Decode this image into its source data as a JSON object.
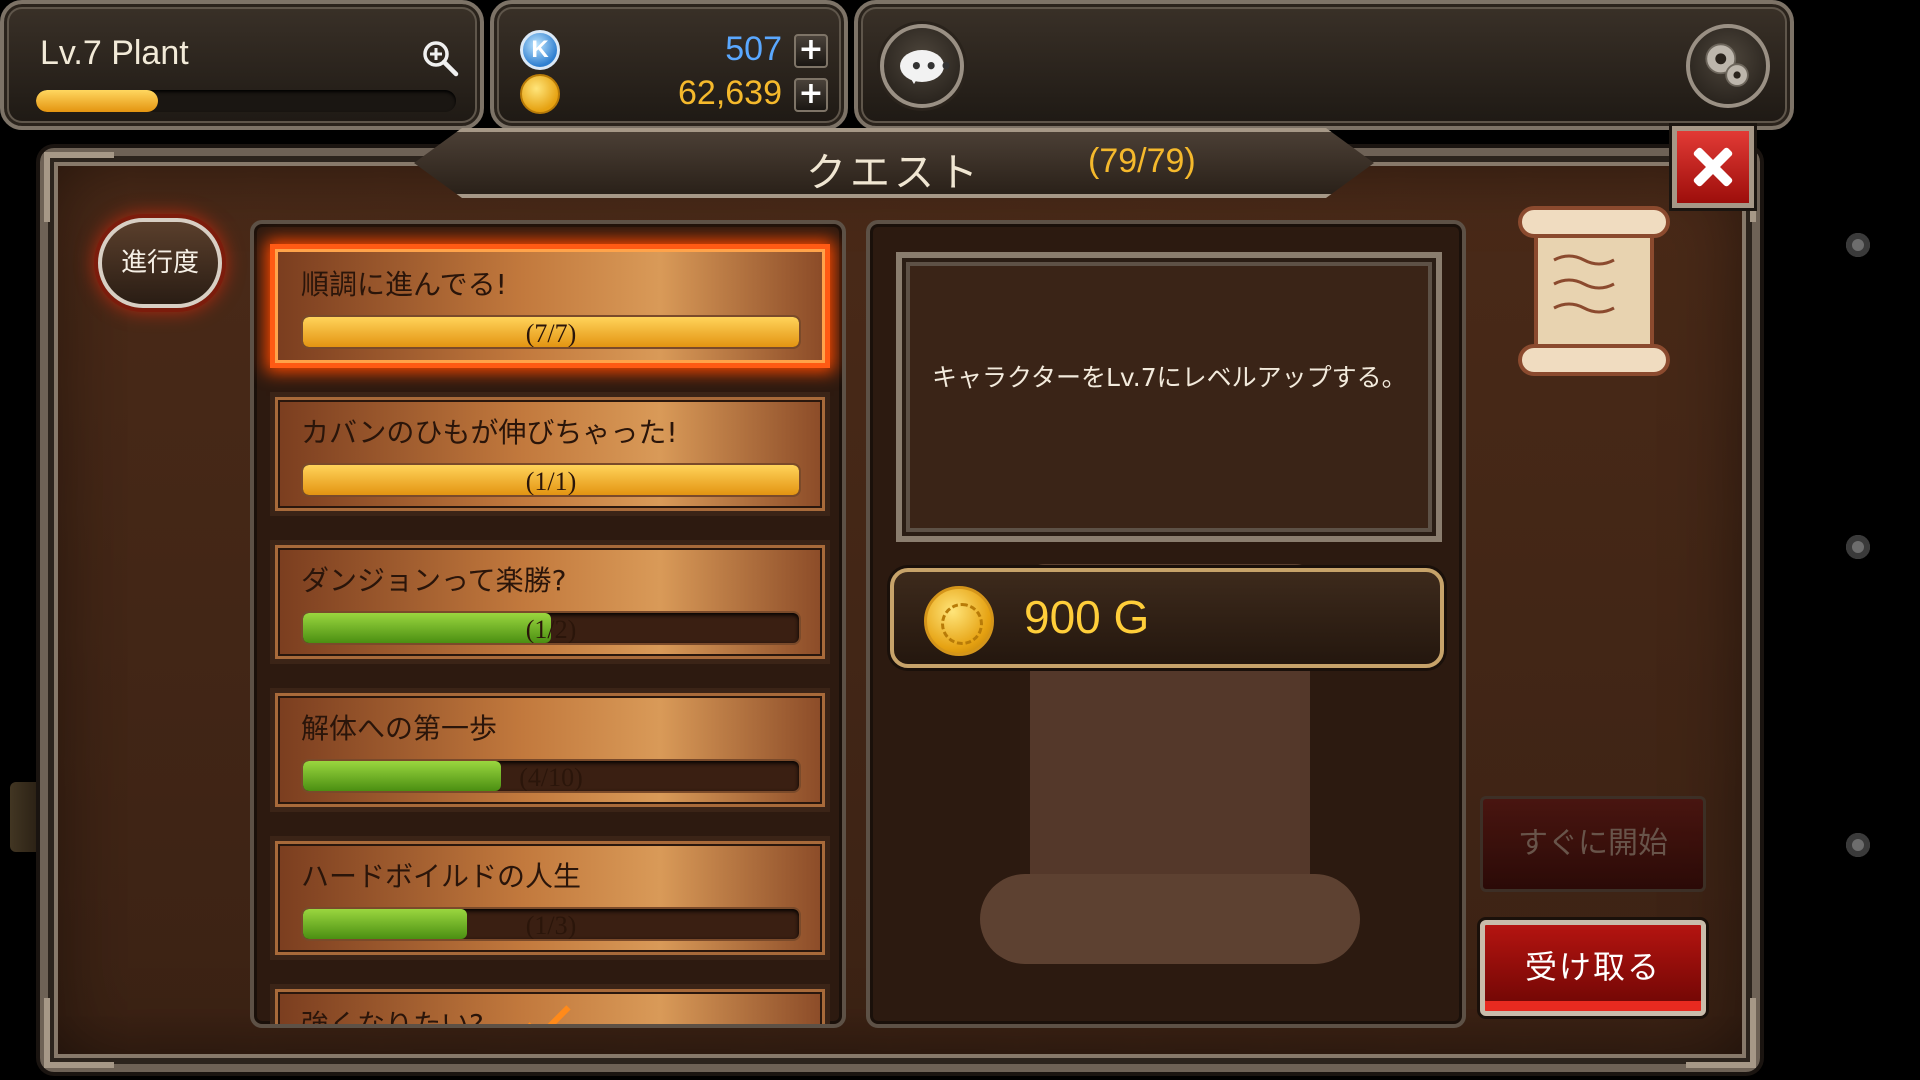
{
  "hud": {
    "player_level_name": "Lv.7  Plant",
    "xp_progress": 0.29,
    "currency_k": {
      "icon": "k-coin-icon",
      "letter": "K",
      "value": "507",
      "color": "#5aa8ff"
    },
    "currency_gold": {
      "icon": "gold-coin-icon",
      "value": "62,639",
      "color": "#f5b92c"
    },
    "plus_label": "+",
    "chat_icon": "chat-bubble-icon",
    "settings_icon": "gear-icon"
  },
  "window": {
    "title": "クエスト",
    "count": "(79/79)",
    "close_icon": "close-icon",
    "progress_button": "進行度"
  },
  "quests": [
    {
      "title": "順調に進んでる!",
      "count": "(7/7)",
      "progress": 1.0,
      "color": "gold",
      "selected": true
    },
    {
      "title": "カバンのひもが伸びちゃった!",
      "count": "(1/1)",
      "progress": 1.0,
      "color": "gold",
      "selected": false
    },
    {
      "title": "ダンジョンって楽勝?",
      "count": "(1/2)",
      "progress": 0.5,
      "color": "green",
      "selected": false
    },
    {
      "title": "解体への第一歩",
      "count": "(4/10)",
      "progress": 0.4,
      "color": "green",
      "selected": false
    },
    {
      "title": "ハードボイルドの人生",
      "count": "(1/3)",
      "progress": 0.33,
      "color": "green",
      "selected": false
    },
    {
      "title": "強くなりたい?",
      "count": "",
      "progress": 0,
      "color": "green",
      "selected": false
    }
  ],
  "detail": {
    "description": "キャラクターをLv.7にレベルアップする。",
    "reward": "900 G",
    "reward_icon": "gold-coin-icon"
  },
  "actions": {
    "start_now": "すぐに開始",
    "receive": "受け取る"
  },
  "colors": {
    "accent_orange": "#ff5a14",
    "gold_text": "#f5b92c",
    "close_red": "#e23a35"
  }
}
